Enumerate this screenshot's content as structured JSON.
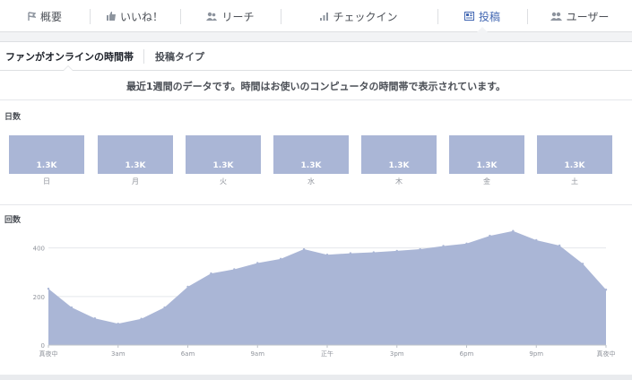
{
  "nav": {
    "items": [
      {
        "label": "概要",
        "icon": "pencil-flag-icon",
        "active": false
      },
      {
        "label": "いいね！",
        "icon": "thumbs-up-icon",
        "active": false
      },
      {
        "label": "リーチ",
        "icon": "people-icon",
        "active": false
      },
      {
        "label": "チェックイン",
        "icon": "bar-chart-icon",
        "active": false
      },
      {
        "label": "投稿",
        "icon": "post-icon",
        "active": true
      },
      {
        "label": "ユーザー",
        "icon": "users-icon",
        "active": false
      }
    ]
  },
  "subtabs": {
    "online": "ファンがオンラインの時間帯",
    "post_types": "投稿タイプ"
  },
  "notice": "最近1週間のデータです。時間はお使いのコンピュータの時間帯で表示されています。",
  "days_section": {
    "label": "日数",
    "days": [
      {
        "label": "日",
        "value": "1.3K"
      },
      {
        "label": "月",
        "value": "1.3K"
      },
      {
        "label": "火",
        "value": "1.3K"
      },
      {
        "label": "水",
        "value": "1.3K"
      },
      {
        "label": "木",
        "value": "1.3K"
      },
      {
        "label": "金",
        "value": "1.3K"
      },
      {
        "label": "土",
        "value": "1.3K"
      }
    ]
  },
  "times_section": {
    "label": "回数"
  },
  "colors": {
    "accent": "#4267b2",
    "fill": "#aab6d6"
  },
  "chart_data": {
    "type": "area",
    "title": "",
    "xlabel": "",
    "ylabel": "回数",
    "x": [
      0,
      1,
      2,
      3,
      4,
      5,
      6,
      7,
      8,
      9,
      10,
      11,
      12,
      13,
      14,
      15,
      16,
      17,
      18,
      19,
      20,
      21,
      22,
      23,
      24
    ],
    "values": [
      232,
      155,
      110,
      88,
      108,
      155,
      240,
      295,
      312,
      338,
      355,
      395,
      372,
      378,
      382,
      388,
      395,
      408,
      418,
      450,
      470,
      432,
      410,
      335,
      228
    ],
    "ylim": [
      0,
      480
    ],
    "yticks": [
      0,
      200,
      400
    ],
    "xticks": [
      {
        "x": 0,
        "label": "真夜中"
      },
      {
        "x": 3,
        "label": "3am"
      },
      {
        "x": 6,
        "label": "6am"
      },
      {
        "x": 9,
        "label": "9am"
      },
      {
        "x": 12,
        "label": "正午"
      },
      {
        "x": 15,
        "label": "3pm"
      },
      {
        "x": 18,
        "label": "6pm"
      },
      {
        "x": 21,
        "label": "9pm"
      },
      {
        "x": 24,
        "label": "真夜中"
      }
    ],
    "grid": true,
    "legend": "none"
  }
}
